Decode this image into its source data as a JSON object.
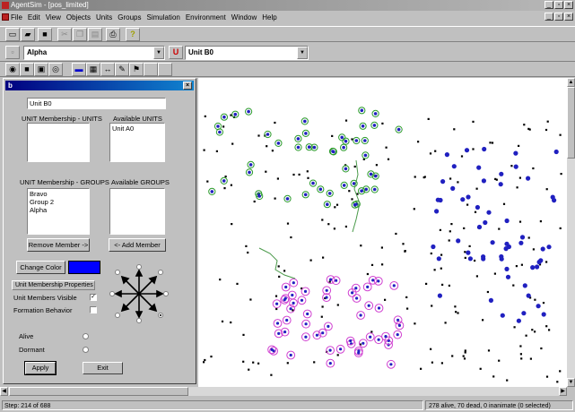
{
  "window": {
    "title": "AgentSim - [pos_limited]"
  },
  "menu": [
    "File",
    "Edit",
    "View",
    "Objects",
    "Units",
    "Groups",
    "Simulation",
    "Environment",
    "Window",
    "Help"
  ],
  "toolbar": {
    "group_combo": "Alpha",
    "unit_combo": "Unit B0"
  },
  "panel": {
    "title": "b",
    "name_value": "Unit B0",
    "unit_membership_label": "UNIT Membership - UNITS",
    "available_units_label": "Available UNITS",
    "available_units": [
      "Unit A0"
    ],
    "group_membership_label": "UNIT Membership - GROUPS",
    "available_groups_label": "Available GROUPS",
    "member_groups": [
      "Bravo",
      "Group 2",
      "Alpha"
    ],
    "remove_button": "Remove Member ->",
    "add_button": "<- Add Member",
    "change_color_button": "Change Color",
    "unit_color": "#0000ff",
    "properties_label": "Unit Membership Properties",
    "members_visible_label": "Unit Members Visible",
    "members_visible_check": "✓",
    "formation_label": "Formation Behavior",
    "alive_label": "Alive",
    "dormant_label": "Dormant",
    "apply_button": "Apply",
    "exit_button": "Exit"
  },
  "status": {
    "step": "Step: 214 of 688",
    "summary": "278 alive, 70 dead, 0 inanimate (0 selected)"
  },
  "colors": {
    "green_group": "#2a9a2a",
    "blue_group": "#2020c0",
    "magenta_group": "#d040d0",
    "neutral": "#000000"
  }
}
